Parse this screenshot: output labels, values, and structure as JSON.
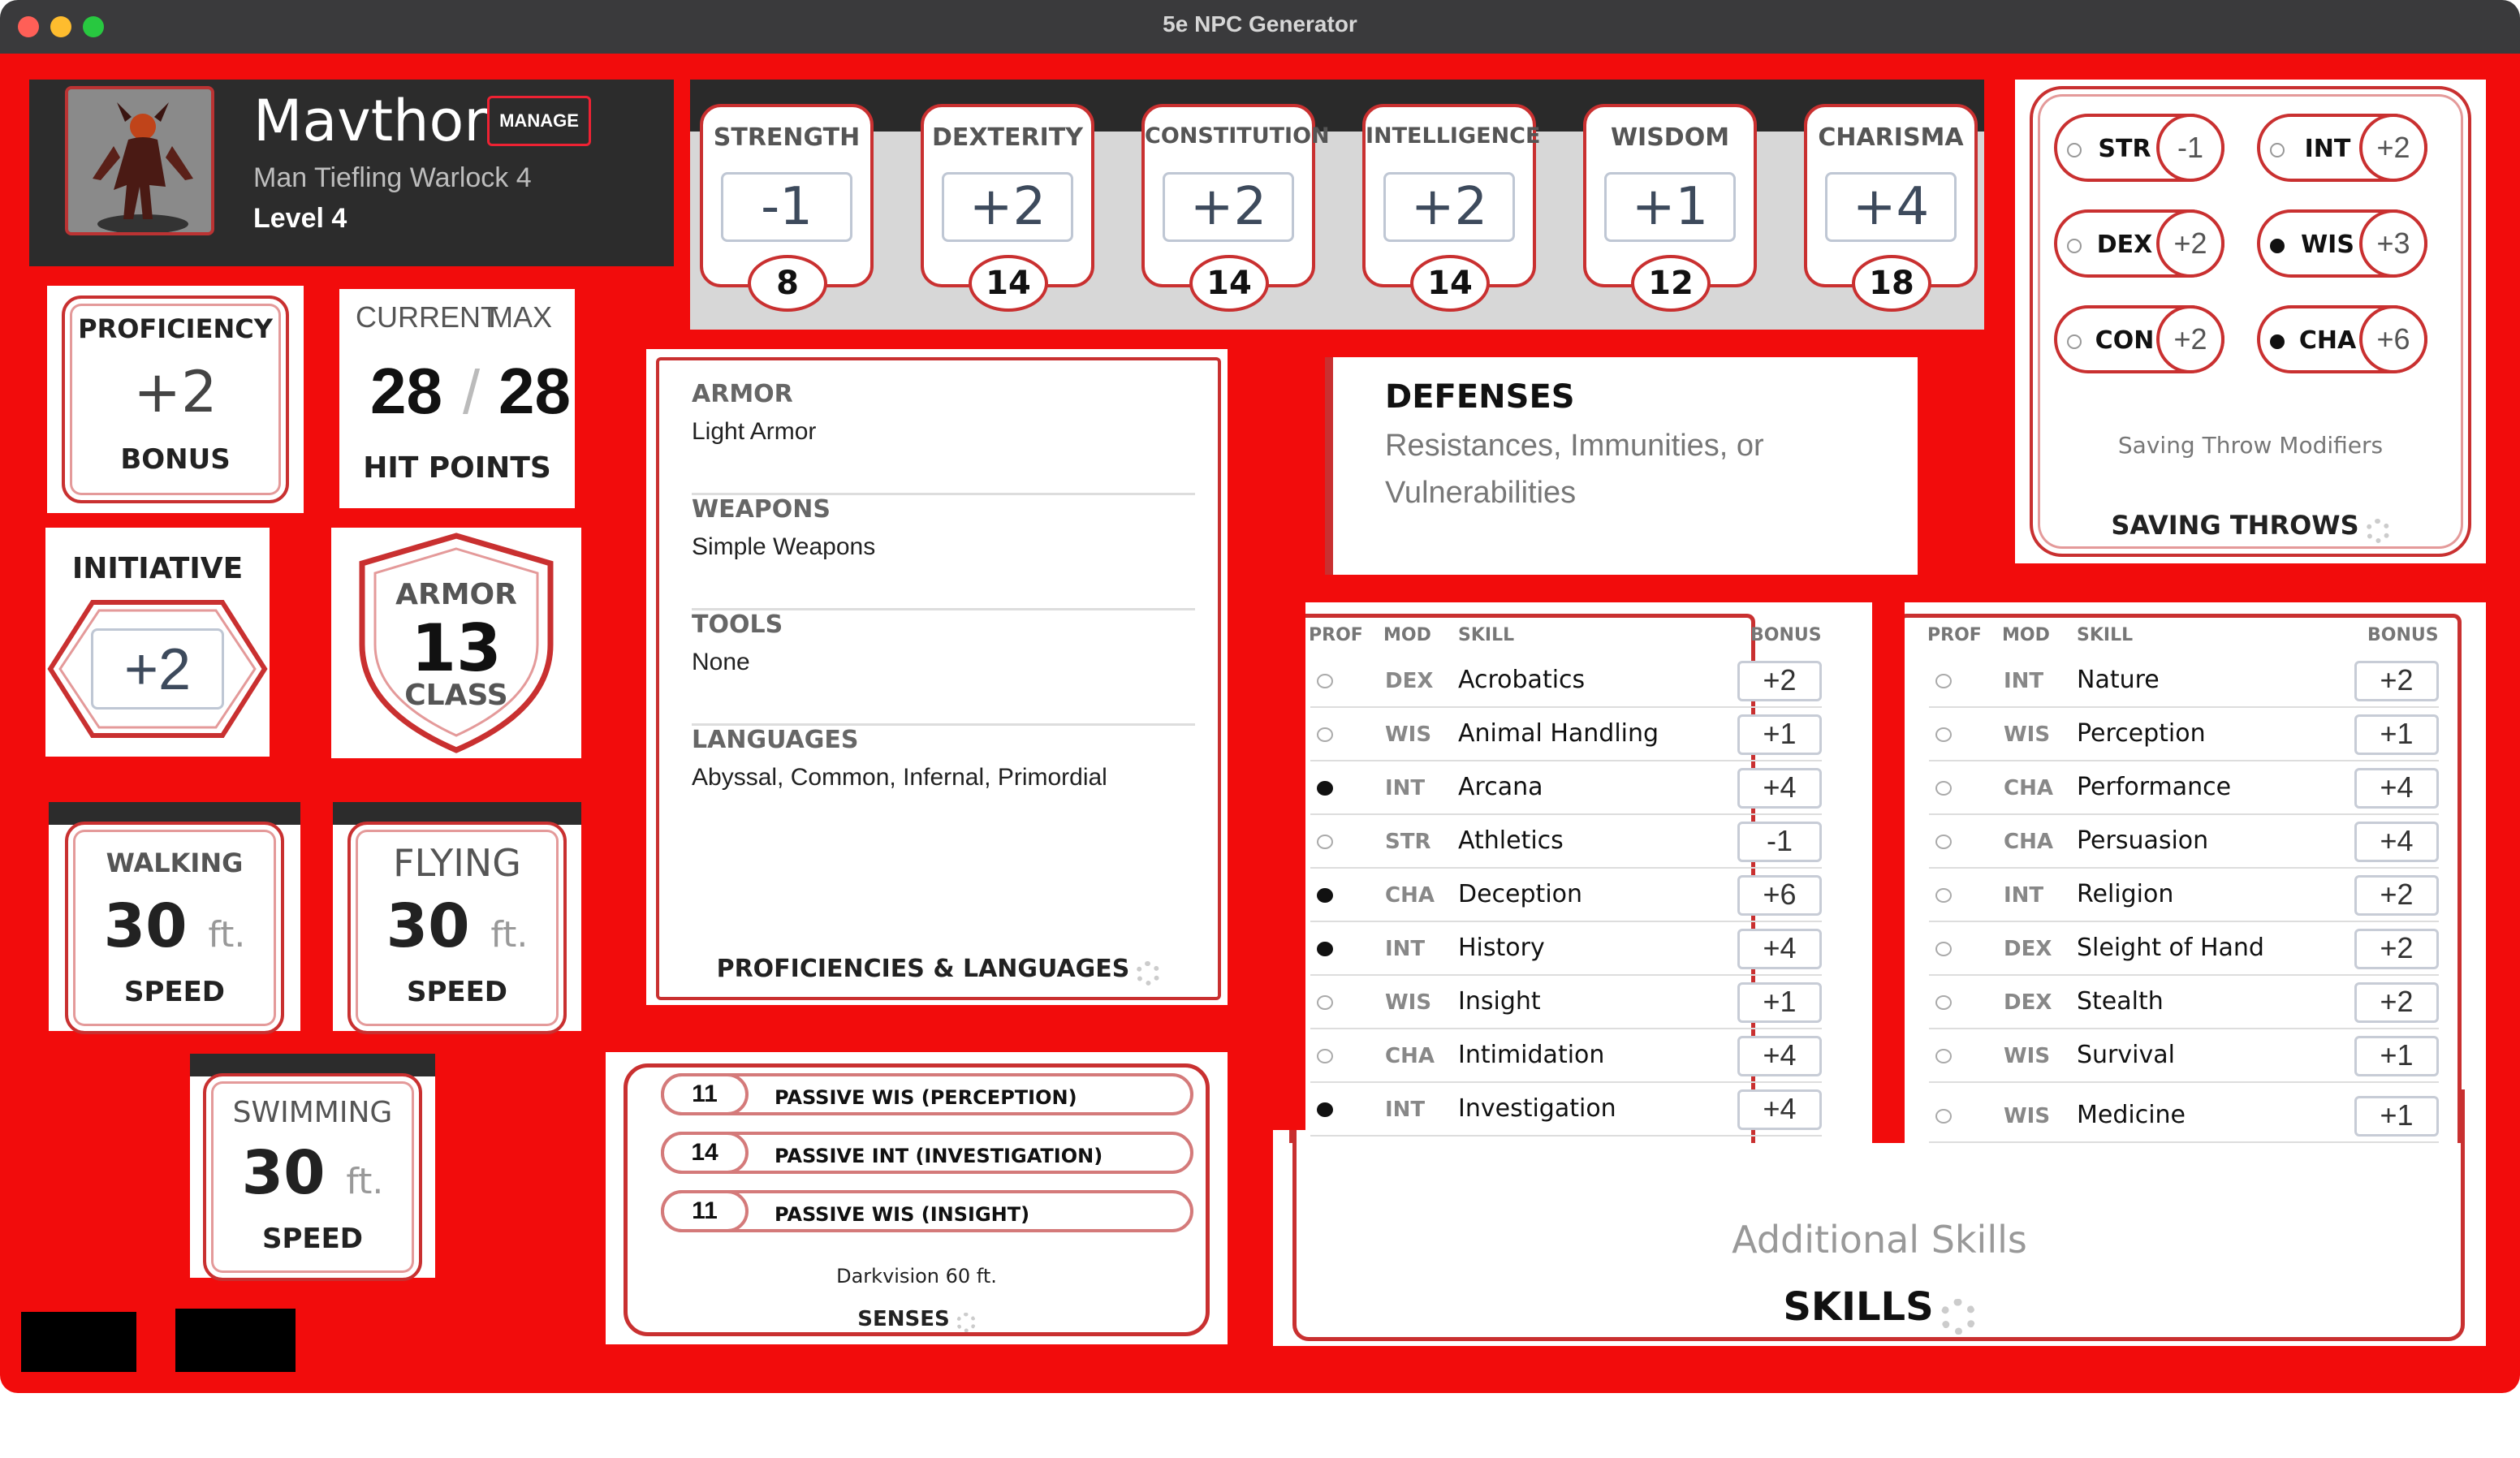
{
  "window": {
    "title": "5e NPC Generator"
  },
  "header": {
    "name": "Mavthor",
    "manage_label": "MANAGE",
    "description": "Man  Tiefling  Warlock 4",
    "level": "Level 4"
  },
  "abilities": [
    {
      "name": "STRENGTH",
      "mod": "-1",
      "score": "8"
    },
    {
      "name": "DEXTERITY",
      "mod": "+2",
      "score": "14"
    },
    {
      "name": "CONSTITUTION",
      "mod": "+2",
      "score": "14"
    },
    {
      "name": "INTELLIGENCE",
      "mod": "+2",
      "score": "14"
    },
    {
      "name": "WISDOM",
      "mod": "+1",
      "score": "12"
    },
    {
      "name": "CHARISMA",
      "mod": "+4",
      "score": "18"
    }
  ],
  "saving_throws": {
    "items": [
      {
        "abbr": "STR",
        "bonus": "-1",
        "proficient": false
      },
      {
        "abbr": "INT",
        "bonus": "+2",
        "proficient": false
      },
      {
        "abbr": "DEX",
        "bonus": "+2",
        "proficient": false
      },
      {
        "abbr": "WIS",
        "bonus": "+3",
        "proficient": true
      },
      {
        "abbr": "CON",
        "bonus": "+2",
        "proficient": false
      },
      {
        "abbr": "CHA",
        "bonus": "+6",
        "proficient": true
      }
    ],
    "caption": "Saving Throw Modifiers",
    "title": "SAVING THROWS"
  },
  "proficiency": {
    "title": "PROFICIENCY",
    "value": "+2",
    "sub": "BONUS"
  },
  "hit_points": {
    "current_label": "CURRENT",
    "max_label": "MAX",
    "current": "28",
    "sep": "/",
    "max": "28",
    "title": "HIT POINTS"
  },
  "initiative": {
    "title": "INITIATIVE",
    "value": "+2"
  },
  "armor": {
    "top": "ARMOR",
    "value": "13",
    "bottom": "CLASS"
  },
  "speeds": [
    {
      "title": "WALKING",
      "value": "30",
      "unit": "ft.",
      "sub": "SPEED"
    },
    {
      "title": "FLYING",
      "value": "30",
      "unit": "ft.",
      "sub": "SPEED"
    },
    {
      "title": "SWIMMING",
      "value": "30",
      "unit": "ft.",
      "sub": "SPEED"
    }
  ],
  "proficiencies": {
    "blocks": [
      {
        "heading": "ARMOR",
        "value": "Light Armor"
      },
      {
        "heading": "WEAPONS",
        "value": "Simple Weapons"
      },
      {
        "heading": "TOOLS",
        "value": "None"
      },
      {
        "heading": "LANGUAGES",
        "value": "Abyssal, Common, Infernal, Primordial"
      }
    ],
    "title": "PROFICIENCIES & LANGUAGES"
  },
  "defenses": {
    "title": "DEFENSES",
    "subtitle": "Resistances, Immunities, or Vulnerabilities"
  },
  "senses": {
    "passives": [
      {
        "value": "11",
        "label": "PASSIVE WIS (PERCEPTION)"
      },
      {
        "value": "14",
        "label": "PASSIVE INT (INVESTIGATION)"
      },
      {
        "value": "11",
        "label": "PASSIVE WIS (INSIGHT)"
      }
    ],
    "note": "Darkvision 60 ft.",
    "title": "SENSES"
  },
  "skills": {
    "headers": {
      "prof": "PROF",
      "mod": "MOD",
      "skill": "SKILL",
      "bonus": "BONUS"
    },
    "left": [
      {
        "mod": "DEX",
        "name": "Acrobatics",
        "bonus": "+2",
        "proficient": false
      },
      {
        "mod": "WIS",
        "name": "Animal Handling",
        "bonus": "+1",
        "proficient": false
      },
      {
        "mod": "INT",
        "name": "Arcana",
        "bonus": "+4",
        "proficient": true
      },
      {
        "mod": "STR",
        "name": "Athletics",
        "bonus": "-1",
        "proficient": false
      },
      {
        "mod": "CHA",
        "name": "Deception",
        "bonus": "+6",
        "proficient": true
      },
      {
        "mod": "INT",
        "name": "History",
        "bonus": "+4",
        "proficient": true
      },
      {
        "mod": "WIS",
        "name": "Insight",
        "bonus": "+1",
        "proficient": false
      },
      {
        "mod": "CHA",
        "name": "Intimidation",
        "bonus": "+4",
        "proficient": false
      },
      {
        "mod": "INT",
        "name": "Investigation",
        "bonus": "+4",
        "proficient": true
      }
    ],
    "right": [
      {
        "mod": "INT",
        "name": "Nature",
        "bonus": "+2",
        "proficient": false
      },
      {
        "mod": "WIS",
        "name": "Perception",
        "bonus": "+1",
        "proficient": false
      },
      {
        "mod": "CHA",
        "name": "Performance",
        "bonus": "+4",
        "proficient": false
      },
      {
        "mod": "CHA",
        "name": "Persuasion",
        "bonus": "+4",
        "proficient": false
      },
      {
        "mod": "INT",
        "name": "Religion",
        "bonus": "+2",
        "proficient": false
      },
      {
        "mod": "DEX",
        "name": "Sleight of Hand",
        "bonus": "+2",
        "proficient": false
      },
      {
        "mod": "DEX",
        "name": "Stealth",
        "bonus": "+2",
        "proficient": false
      },
      {
        "mod": "WIS",
        "name": "Survival",
        "bonus": "+1",
        "proficient": false
      },
      {
        "mod": "WIS",
        "name": "Medicine",
        "bonus": "+1",
        "proficient": false
      }
    ],
    "additional_label": "Additional Skills",
    "title": "SKILLS"
  },
  "colors": {
    "accent": "#f20c0c",
    "frame": "#c93030",
    "header_bg": "#2c2c2c"
  },
  "icons": {
    "settings": "gear-icon",
    "proficient": "filled-dot-icon",
    "not_proficient": "empty-dot-icon"
  }
}
